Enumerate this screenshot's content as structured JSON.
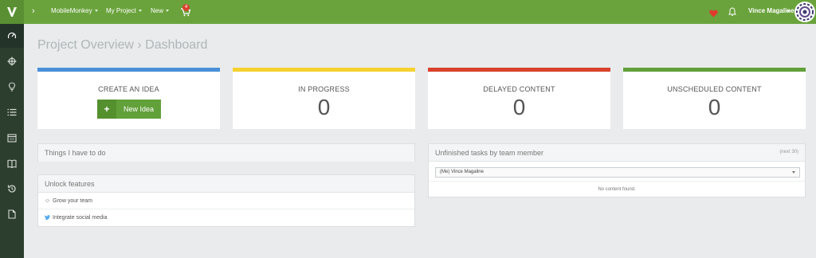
{
  "topbar": {
    "nav": [
      {
        "label": "MobileMonkey"
      },
      {
        "label": "My Project"
      },
      {
        "label": "New"
      }
    ],
    "cart_badge": "4",
    "user_name": "Vince Magaline",
    "accent_color": "#6aa33c",
    "icons": [
      "logo-icon",
      "chevron-right-icon",
      "cart-icon",
      "heart-icon",
      "bell-icon",
      "avatar"
    ]
  },
  "sidebar": {
    "items": [
      {
        "icon": "dashboard-icon"
      },
      {
        "icon": "crosshair-icon"
      },
      {
        "icon": "lightbulb-icon"
      },
      {
        "icon": "list-icon"
      },
      {
        "icon": "calendar-icon"
      },
      {
        "icon": "book-icon"
      },
      {
        "icon": "history-icon"
      },
      {
        "icon": "document-icon"
      }
    ]
  },
  "main": {
    "title": "Project Overview › Dashboard",
    "cards": [
      {
        "title": "CREATE AN IDEA",
        "button": "New Idea",
        "color": "#4a90d9"
      },
      {
        "title": "IN PROGRESS",
        "count": "0",
        "color": "#f5d130"
      },
      {
        "title": "DELAYED CONTENT",
        "count": "0",
        "color": "#d9412c"
      },
      {
        "title": "UNSCHEDULED CONTENT",
        "count": "0",
        "color": "#62a03a"
      }
    ],
    "todo_panel": {
      "title": "Things I have to do"
    },
    "unlock_panel": {
      "title": "Unlock features",
      "items": [
        {
          "label": "Grow your team",
          "icon": "smiley-icon"
        },
        {
          "label": "Integrate social media",
          "icon": "twitter-icon"
        }
      ]
    },
    "tasks_panel": {
      "title": "Unfinished tasks by team member",
      "meta": "(next 30)",
      "selected_member": "(Me) Vince Magaline",
      "empty_text": "No content found."
    }
  }
}
